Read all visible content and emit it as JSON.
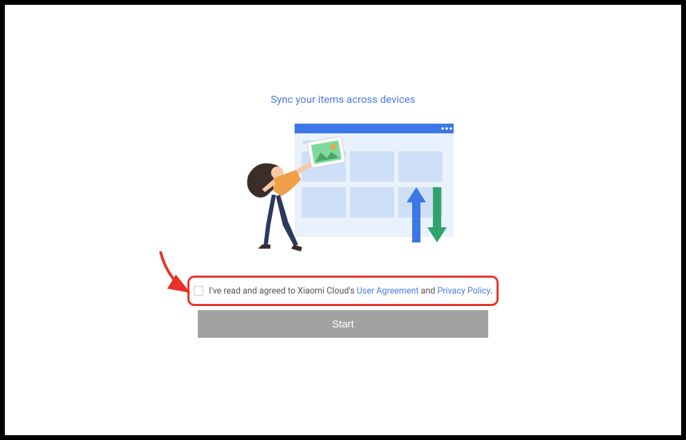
{
  "title": "Sync your items across devices",
  "agreement": {
    "prefix": "I've read and agreed to Xiaomi Cloud's ",
    "link1": "User Agreement",
    "middle": " and ",
    "link2": "Privacy Policy",
    "suffix": "."
  },
  "start_label": "Start",
  "colors": {
    "accent": "#4a7be5",
    "button_disabled": "#a2a2a2",
    "highlight": "#e8322a"
  }
}
